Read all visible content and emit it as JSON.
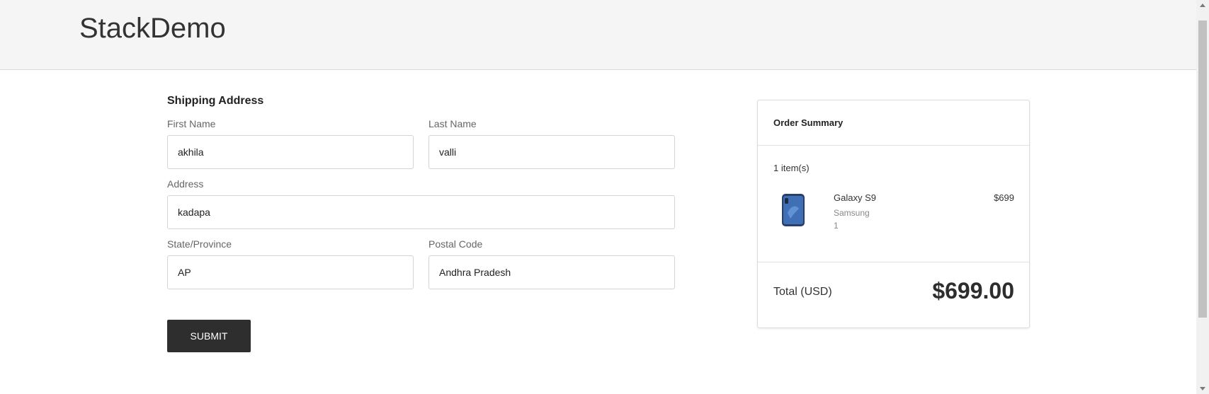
{
  "header": {
    "logo": "StackDemo"
  },
  "shipping": {
    "title": "Shipping Address",
    "first_name": {
      "label": "First Name",
      "value": "akhila"
    },
    "last_name": {
      "label": "Last Name",
      "value": "valli"
    },
    "address": {
      "label": "Address",
      "value": "kadapa"
    },
    "state": {
      "label": "State/Province",
      "value": "AP"
    },
    "postal_code": {
      "label": "Postal Code",
      "value": "Andhra Pradesh"
    },
    "submit_label": "SUBMIT"
  },
  "order_summary": {
    "title": "Order Summary",
    "item_count": "1 item(s)",
    "items": [
      {
        "name": "Galaxy S9",
        "brand": "Samsung",
        "quantity": "1",
        "price": "$699",
        "icon": "phone-image"
      }
    ],
    "total_label": "Total (USD)",
    "total_value": "$699.00"
  },
  "colors": {
    "topbar_bg": "#f5f5f5",
    "button_bg": "#2e2e2e",
    "phone_blue": "#3f6fb5"
  }
}
